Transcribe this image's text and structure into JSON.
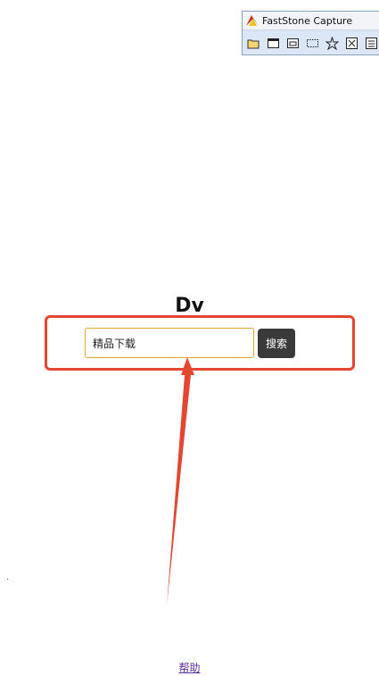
{
  "faststone": {
    "title": "FastStone Capture",
    "tools": [
      {
        "icon": "open-folder-icon"
      },
      {
        "icon": "capture-window-icon"
      },
      {
        "icon": "capture-object-icon"
      },
      {
        "icon": "capture-rectangle-icon"
      },
      {
        "icon": "capture-freehand-icon"
      },
      {
        "icon": "capture-fullscreen-icon"
      },
      {
        "icon": "capture-scrolling-icon"
      }
    ]
  },
  "page": {
    "brand": "Dv",
    "search": {
      "value": "精品下载",
      "button_label": "搜索"
    },
    "help_link": "帮助"
  },
  "annotation": {
    "highlight_color": "#e44731"
  }
}
